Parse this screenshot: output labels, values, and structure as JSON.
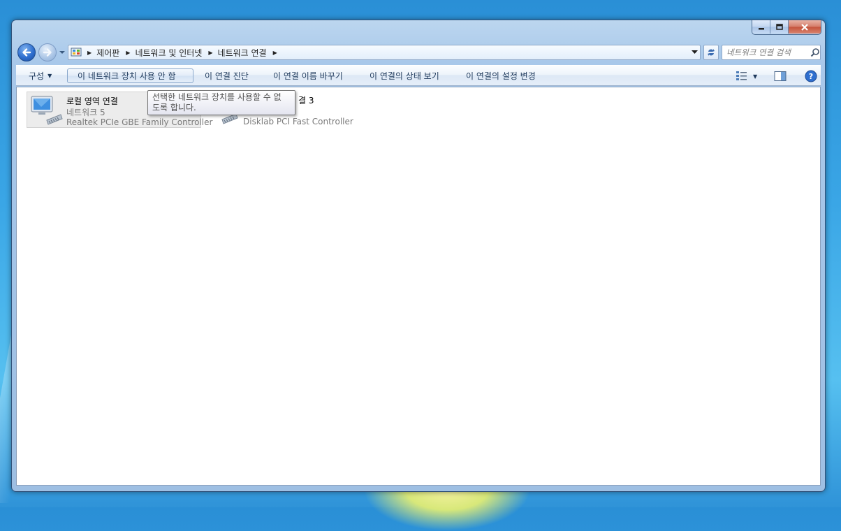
{
  "window": {
    "controls": {
      "minimize": "minimize",
      "maximize": "maximize",
      "close": "close"
    }
  },
  "address": {
    "breadcrumbs": [
      "제어판",
      "네트워크 및 인터넷",
      "네트워크 연결"
    ],
    "icon": "control-panel-icon"
  },
  "search": {
    "placeholder": "네트워크 연결 검색"
  },
  "toolbar": {
    "organize": "구성",
    "disable_device": "이 네트워크 장치 사용 안 함",
    "diagnose": "이 연결 진단",
    "rename": "이 연결 이름 바꾸기",
    "view_status": "이 연결의 상태 보기",
    "change_settings": "이 연결의 설정 변경",
    "icons": [
      "view-options-icon",
      "preview-pane-icon",
      "help-icon"
    ]
  },
  "connections": [
    {
      "name": "로컬 영역 연결",
      "network": "네트워크  5",
      "device": "Realtek PCIe GBE Family Controller",
      "selected": true
    },
    {
      "name_fragment": "결 3",
      "device": "Disklab PCI Fast Controller",
      "selected": false
    }
  ],
  "tooltip": {
    "line1": "선택한 네트워크 장치를 사용할 수 없",
    "line2": "도록 합니다."
  },
  "colors": {
    "accent": "#2f6fcf",
    "toolbar_text": "#1e395b",
    "secondary_text": "#7a7a7a",
    "close_button": "#c4523b"
  }
}
